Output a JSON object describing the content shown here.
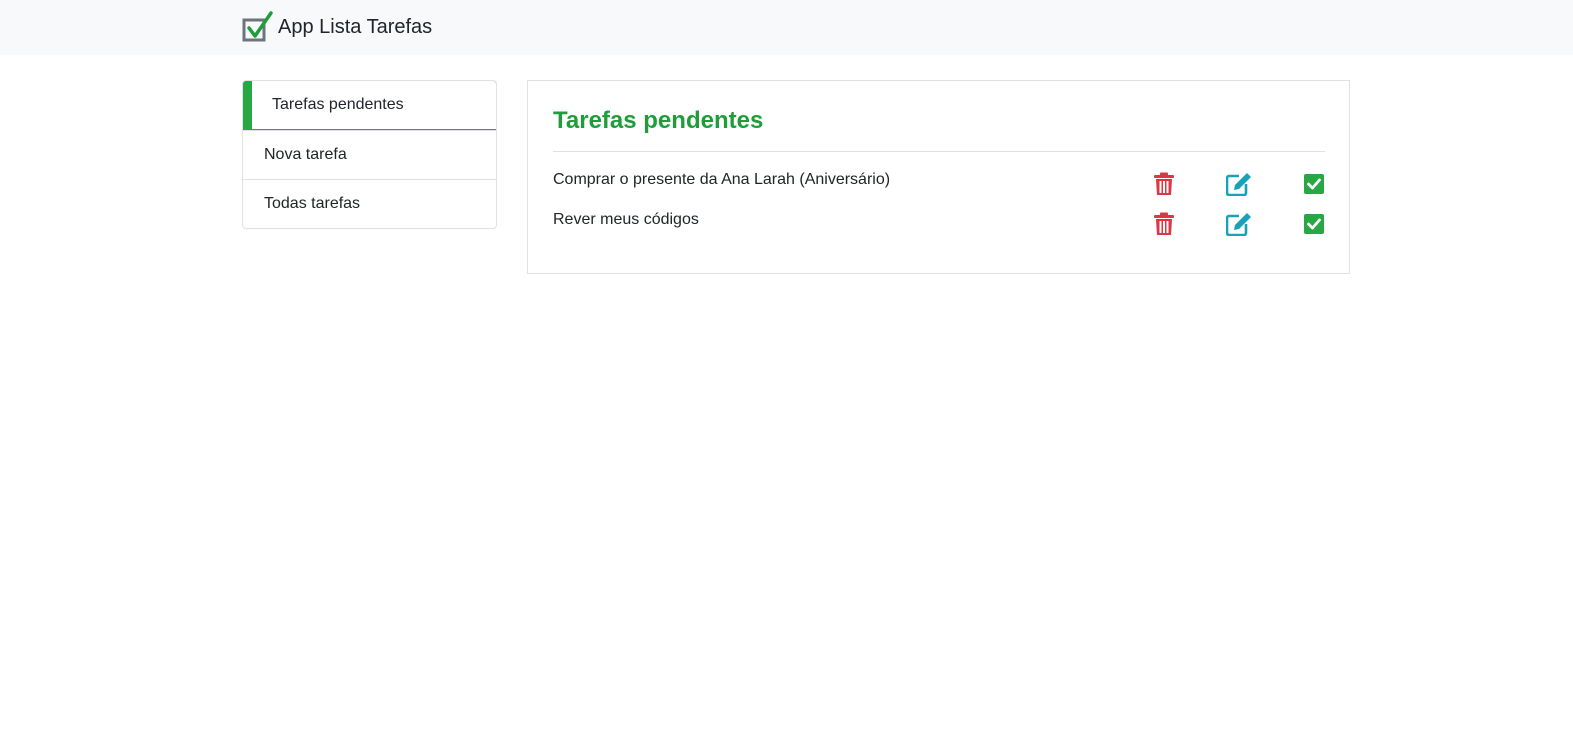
{
  "navbar": {
    "brand_icon": "checkbox-check-logo-icon",
    "brand_text": "App Lista Tarefas"
  },
  "sidebar": {
    "items": [
      {
        "label": "Tarefas pendentes",
        "active": true
      },
      {
        "label": "Nova tarefa",
        "active": false
      },
      {
        "label": "Todas tarefas",
        "active": false
      }
    ]
  },
  "main": {
    "title": "Tarefas pendentes",
    "tasks": [
      {
        "text": "Comprar o presente da Ana Larah (Aniversário)"
      },
      {
        "text": "Rever meus códigos"
      }
    ],
    "actions": {
      "delete_icon": "trash-icon",
      "edit_icon": "edit-icon",
      "done_icon": "check-square-icon"
    }
  },
  "colors": {
    "accent": "#28a745",
    "title": "#1f9d3b",
    "danger": "#dc3545",
    "info": "#17a2b8",
    "success": "#28a745",
    "navbar_bg": "#f8f9fa"
  }
}
